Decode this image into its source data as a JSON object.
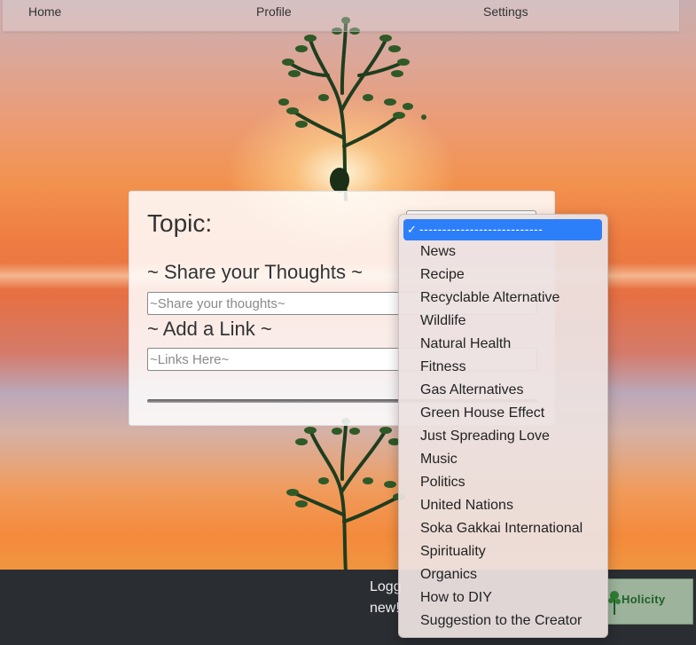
{
  "nav": {
    "home": "Home",
    "profile": "Profile",
    "settings": "Settings"
  },
  "form": {
    "topic_label": "Topic:",
    "thoughts_heading": "~ Share your Thoughts ~",
    "thoughts_placeholder": "~Share your thoughts~",
    "link_heading": "~ Add a Link ~",
    "link_placeholder": "~Links Here~"
  },
  "dropdown": {
    "selected": "---------------------------",
    "options": [
      "News",
      "Recipe",
      "Recyclable Alternative",
      "Wildlife",
      "Natural Health",
      "Fitness",
      "Gas Alternatives",
      "Green House Effect",
      "Just Spreading Love",
      "Music",
      "Politics",
      "United Nations",
      "Soka Gakkai International",
      "Spirituality",
      "Organics",
      "How to DIY",
      "Suggestion to the Creator"
    ]
  },
  "footer": {
    "line1": "Logg",
    "line2": "new!"
  },
  "logo": {
    "text": "Holicity"
  },
  "colors": {
    "accent": "#2d7ff9",
    "footer": "#2a2d31",
    "tree": "#1f3d1f"
  },
  "icons": {
    "check": "check-icon",
    "tree": "tree-icon"
  }
}
